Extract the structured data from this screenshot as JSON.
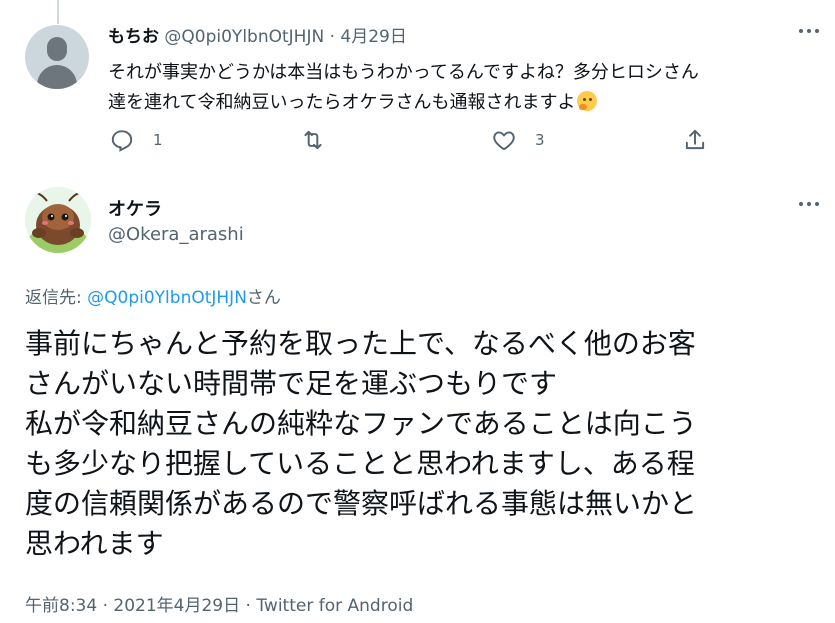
{
  "reply_tweet": {
    "display_name": "もちお",
    "handle": "@Q0pi0YlbnOtJHJN",
    "separator": "·",
    "date": "4月29日",
    "text_line1": "それが事実かどうかは本当はもうわかってるんですよね？多分ヒロシさん",
    "text_line2": "達を連れて令和納豆いったらオケラさんも通報されますよ",
    "emoji": "thinking-face",
    "actions": {
      "reply_count": "1",
      "retweet_count": "",
      "like_count": "3"
    }
  },
  "main_tweet": {
    "display_name": "オケラ",
    "handle": "@Okera_arashi",
    "reply_label": "返信先: ",
    "reply_mention": "@Q0pi0YlbnOtJHJN",
    "reply_suffix": "さん",
    "text": "事前にちゃんと予約を取った上で、なるべく他のお客\nさんがいない時間帯で足を運ぶつもりです\n私が令和納豆さんの純粋なファンであることは向こう\nも多少なり把握していることと思われますし、ある程\n度の信頼関係があるので警察呼ばれる事態は無いかと\n思われます",
    "time": "午前8:34",
    "separator": " · ",
    "date": "2021年4月29日",
    "source": "Twitter for Android"
  },
  "colors": {
    "text": "#0f1419",
    "secondary": "#536471",
    "link": "#1d9bf0",
    "thread_line": "#cfd9de"
  },
  "icons": [
    "more-icon",
    "reply-icon",
    "retweet-icon",
    "like-icon",
    "share-icon"
  ]
}
